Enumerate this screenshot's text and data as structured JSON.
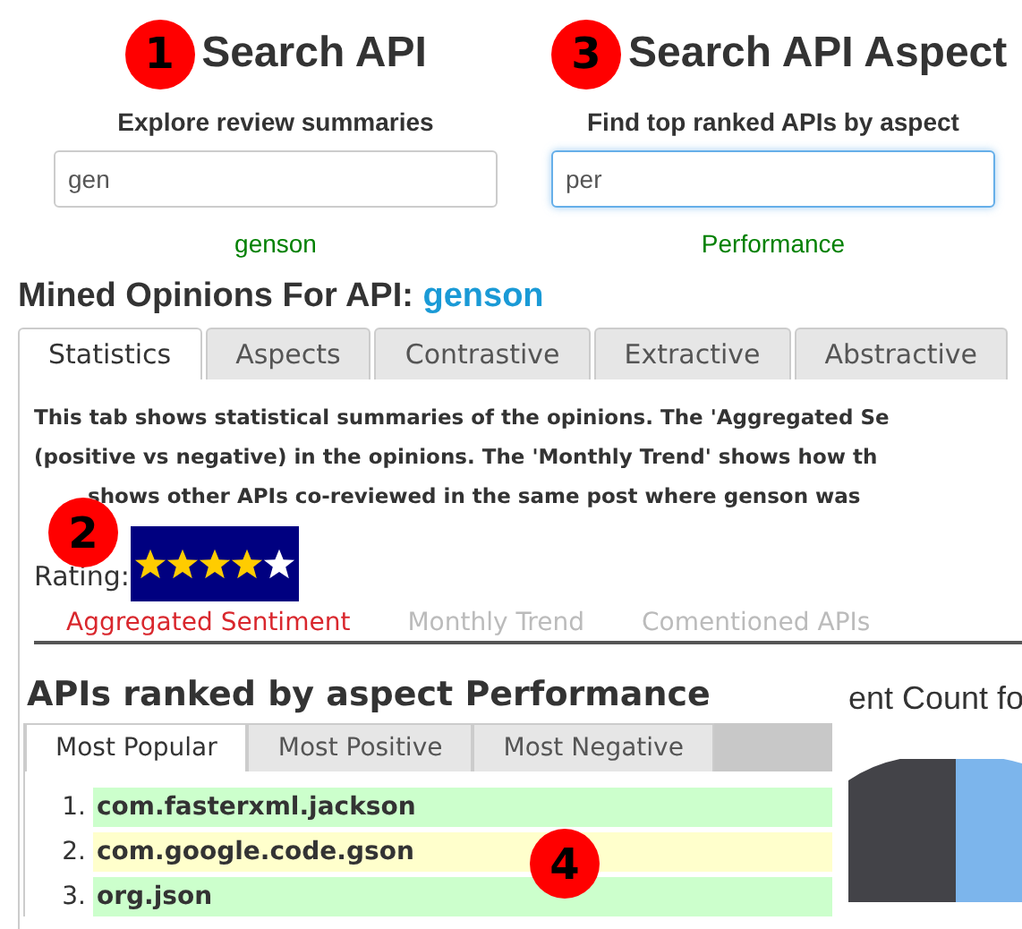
{
  "search_columns": [
    {
      "heading": "Search API",
      "subtitle": "Explore review summaries",
      "value": "gen",
      "suggestion": "genson",
      "focused": false,
      "badge": "1"
    },
    {
      "heading": "Search API Aspect",
      "subtitle": "Find top ranked APIs by aspect",
      "value": "per",
      "suggestion": "Performance",
      "focused": true,
      "badge": "3"
    }
  ],
  "mined": {
    "label": "Mined Opinions For API:",
    "api": "genson"
  },
  "tabs": [
    {
      "label": "Statistics",
      "selected": true
    },
    {
      "label": "Aspects",
      "selected": false
    },
    {
      "label": "Contrastive",
      "selected": false
    },
    {
      "label": "Extractive",
      "selected": false
    },
    {
      "label": "Abstractive",
      "selected": false
    }
  ],
  "description_lines": [
    "This tab shows statistical summaries of the opinions. The 'Aggregated Se",
    "(positive vs negative) in the opinions. The 'Monthly Trend' shows how th",
    "shows other APIs co-reviewed in the same post where genson was"
  ],
  "rating": {
    "label": "Rating:",
    "stars": 4,
    "badge": "2"
  },
  "sub_tabs": [
    {
      "label": "Aggregated Sentiment",
      "selected": true
    },
    {
      "label": "Monthly Trend",
      "selected": false
    },
    {
      "label": "Comentioned APIs",
      "selected": false
    }
  ],
  "chart_title": "ent Count fo",
  "ranked_panel": {
    "title": "APIs ranked by aspect Performance",
    "badge": "4",
    "tabs": [
      {
        "label": "Most Popular",
        "selected": true
      },
      {
        "label": "Most Positive",
        "selected": false
      },
      {
        "label": "Most Negative",
        "selected": false
      }
    ],
    "items": [
      {
        "number": "1.",
        "name": "com.fasterxml.jackson",
        "color": "#ccffcc"
      },
      {
        "number": "2.",
        "name": "com.google.code.gson",
        "color": "#ffffcc"
      },
      {
        "number": "3.",
        "name": "org.json",
        "color": "#ccffcc"
      }
    ]
  }
}
